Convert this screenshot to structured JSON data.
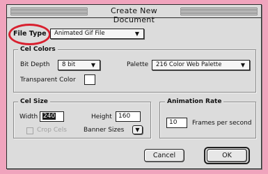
{
  "window": {
    "title": "Create New Document"
  },
  "file_type": {
    "label": "File Type",
    "value": "Animated Gif File"
  },
  "cel_colors": {
    "title": "Cel Colors",
    "bit_depth_label": "Bit Depth",
    "bit_depth_value": "8 bit",
    "palette_label": "Palette",
    "palette_value": "216 Color Web Palette",
    "transparent_label": "Transparent Color"
  },
  "cel_size": {
    "title": "Cel Size",
    "width_label": "Width",
    "width_value": "240",
    "height_label": "Height",
    "height_value": "160",
    "crop_label": "Crop Cels",
    "banner_label": "Banner Sizes"
  },
  "animation_rate": {
    "title": "Animation Rate",
    "value": "10",
    "unit_label": "Frames per second"
  },
  "buttons": {
    "cancel": "Cancel",
    "ok": "OK"
  },
  "icons": {
    "dropdown": "chevron-down-icon"
  },
  "colors": {
    "background": "#f0a4bd",
    "window": "#dcdcdc",
    "highlight": "#d8202f"
  }
}
